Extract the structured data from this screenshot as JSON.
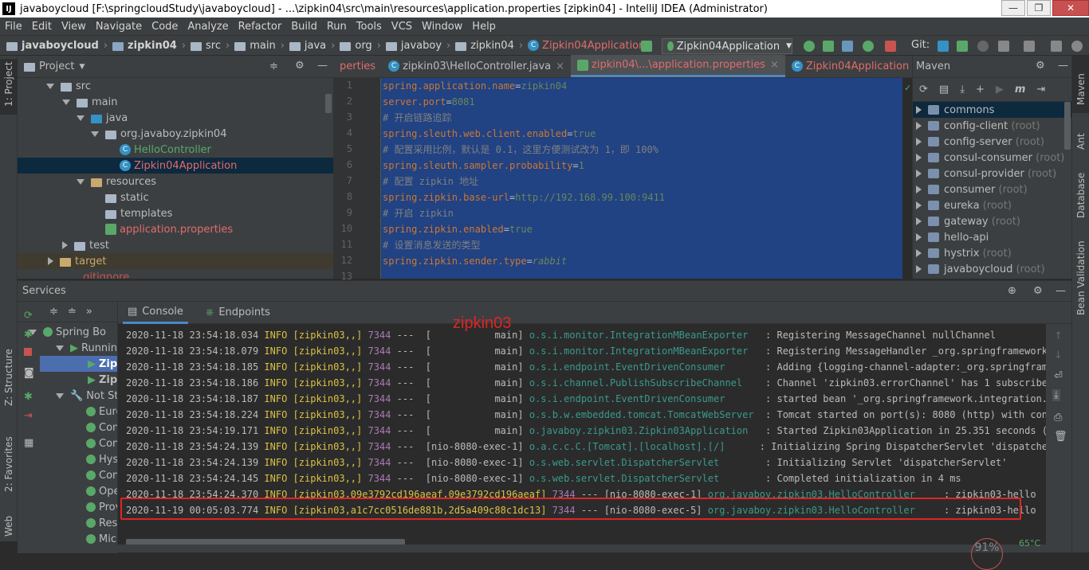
{
  "window": {
    "title": "javaboycloud [F:\\springcloudStudy\\javaboycloud] - ...\\zipkin04\\src\\main\\resources\\application.properties [zipkin04] - IntelliJ IDEA (Administrator)",
    "app_icon": "IJ"
  },
  "menu": [
    "File",
    "Edit",
    "View",
    "Navigate",
    "Code",
    "Analyze",
    "Refactor",
    "Build",
    "Run",
    "Tools",
    "VCS",
    "Window",
    "Help"
  ],
  "breadcrumb": [
    "javaboycloud",
    "zipkin04",
    "src",
    "main",
    "java",
    "org",
    "javaboy",
    "zipkin04",
    "Zipkin04Application"
  ],
  "run_config": "Zipkin04Application",
  "git_label": "Git:",
  "left_strip": {
    "project": "1: Project",
    "structure": "Z: Structure",
    "favorites": "2: Favorites",
    "web": "Web"
  },
  "right_strip": {
    "maven": "Maven",
    "ant": "Ant",
    "database": "Database",
    "bean": "Bean Validation"
  },
  "project_panel": {
    "title": "Project",
    "tree": [
      {
        "label": "src",
        "depth": 2,
        "open": true
      },
      {
        "label": "main",
        "depth": 3,
        "open": true
      },
      {
        "label": "java",
        "depth": 4,
        "open": true
      },
      {
        "label": "org.javaboy.zipkin04",
        "depth": 5,
        "open": true
      },
      {
        "label": "HelloController",
        "depth": 6
      },
      {
        "label": "Zipkin04Application",
        "depth": 6
      },
      {
        "label": "resources",
        "depth": 4,
        "open": true
      },
      {
        "label": "static",
        "depth": 5
      },
      {
        "label": "templates",
        "depth": 5
      },
      {
        "label": "application.properties",
        "depth": 5
      },
      {
        "label": "test",
        "depth": 3,
        "open": false
      },
      {
        "label": "target",
        "depth": 2,
        "open": false
      },
      {
        "label": ".gitignore",
        "depth": 2
      }
    ]
  },
  "editor": {
    "tabs": [
      "perties",
      "zipkin03\\HelloController.java",
      "zipkin04\\...\\application.properties",
      "Zipkin04Application"
    ],
    "lines": [
      {
        "n": "1",
        "key": "spring.application.name",
        "val": "zipkin04"
      },
      {
        "n": "2",
        "key": "server.port",
        "val": "8081"
      },
      {
        "n": "3",
        "comment": "# 开启链路追踪"
      },
      {
        "n": "4",
        "key": "spring.sleuth.web.client.enabled",
        "val": "true"
      },
      {
        "n": "5",
        "comment": "# 配置采用比例，默认是 0.1，这里方便测试改为 1，即 100%"
      },
      {
        "n": "6",
        "key": "spring.sleuth.sampler.probability",
        "val": "1"
      },
      {
        "n": "7",
        "comment": "# 配置 zipkin 地址"
      },
      {
        "n": "8",
        "key": "spring.zipkin.base-url",
        "val": "http://192.168.99.100:9411"
      },
      {
        "n": "9",
        "comment": "# 开启 zipkin"
      },
      {
        "n": "10",
        "key": "spring.zipkin.enabled",
        "val": "true"
      },
      {
        "n": "11",
        "comment": "# 设置消息发送的类型"
      },
      {
        "n": "12",
        "key": "spring.zipkin.sender.type",
        "val": "rabbit"
      },
      {
        "n": "13",
        "key": "",
        "val": ""
      }
    ]
  },
  "maven": {
    "title": "Maven",
    "projects": [
      {
        "name": "commons",
        "suffix": ""
      },
      {
        "name": "config-client",
        "suffix": "(root)"
      },
      {
        "name": "config-server",
        "suffix": "(root)"
      },
      {
        "name": "consul-consumer",
        "suffix": "(root)"
      },
      {
        "name": "consul-provider",
        "suffix": "(root)"
      },
      {
        "name": "consumer",
        "suffix": "(root)"
      },
      {
        "name": "eureka",
        "suffix": "(root)"
      },
      {
        "name": "gateway",
        "suffix": "(root)"
      },
      {
        "name": "hello-api",
        "suffix": ""
      },
      {
        "name": "hystrix",
        "suffix": "(root)"
      },
      {
        "name": "javaboycloud",
        "suffix": "(root)"
      }
    ]
  },
  "services": {
    "title": "Services",
    "tabs": [
      "Console",
      "Endpoints"
    ],
    "annotation": "zipkin03",
    "tree": [
      {
        "label": "Spring Bo",
        "indent": 14
      },
      {
        "label": "Runnin",
        "indent": 30
      },
      {
        "label": "Zip",
        "indent": 60
      },
      {
        "label": "Zip",
        "indent": 60
      },
      {
        "label": "Not Sta",
        "indent": 30
      },
      {
        "label": "Eure",
        "indent": 60
      },
      {
        "label": "Con",
        "indent": 60
      },
      {
        "label": "Con",
        "indent": 60
      },
      {
        "label": "Hys",
        "indent": 60
      },
      {
        "label": "Con",
        "indent": 60
      },
      {
        "label": "Ope",
        "indent": 60
      },
      {
        "label": "Prov",
        "indent": 60
      },
      {
        "label": "Res",
        "indent": 60
      },
      {
        "label": "Mic",
        "indent": 60
      }
    ],
    "log": [
      {
        "ts": "2020-11-18 23:54:18.034",
        "lvl": "INFO",
        "trace": "[zipkin03,,]",
        "pid": "7344",
        "thread": "---  [           main]",
        "logger": "o.s.i.monitor.IntegrationMBeanExporter  ",
        "msg": " : Registering MessageChannel nullChannel"
      },
      {
        "ts": "2020-11-18 23:54:18.079",
        "lvl": "INFO",
        "trace": "[zipkin03,,]",
        "pid": "7344",
        "thread": "---  [           main]",
        "logger": "o.s.i.monitor.IntegrationMBeanExporter  ",
        "msg": " : Registering MessageHandler _org.springframework.inte"
      },
      {
        "ts": "2020-11-18 23:54:18.185",
        "lvl": "INFO",
        "trace": "[zipkin03,,]",
        "pid": "7344",
        "thread": "---  [           main]",
        "logger": "o.s.i.endpoint.EventDrivenConsumer      ",
        "msg": " : Adding {logging-channel-adapter:_org.springframework"
      },
      {
        "ts": "2020-11-18 23:54:18.186",
        "lvl": "INFO",
        "trace": "[zipkin03,,]",
        "pid": "7344",
        "thread": "---  [           main]",
        "logger": "o.s.i.channel.PublishSubscribeChannel   ",
        "msg": " : Channel 'zipkin03.errorChannel' has 1 subscriber(s)."
      },
      {
        "ts": "2020-11-18 23:54:18.187",
        "lvl": "INFO",
        "trace": "[zipkin03,,]",
        "pid": "7344",
        "thread": "---  [           main]",
        "logger": "o.s.i.endpoint.EventDrivenConsumer      ",
        "msg": " : started bean '_org.springframework.integration.error"
      },
      {
        "ts": "2020-11-18 23:54:18.224",
        "lvl": "INFO",
        "trace": "[zipkin03,,]",
        "pid": "7344",
        "thread": "---  [           main]",
        "logger": "o.s.b.w.embedded.tomcat.TomcatWebServer ",
        "msg": " : Tomcat started on port(s): 8080 (http) with context"
      },
      {
        "ts": "2020-11-18 23:54:19.171",
        "lvl": "INFO",
        "trace": "[zipkin03,,]",
        "pid": "7344",
        "thread": "---  [           main]",
        "logger": "o.javaboy.zipkin03.Zipkin03Application  ",
        "msg": " : Started Zipkin03Application in 25.351 seconds (JVM r"
      },
      {
        "ts": "2020-11-18 23:54:24.139",
        "lvl": "INFO",
        "trace": "[zipkin03,,]",
        "pid": "7344",
        "thread": "---  [nio-8080-exec-1]",
        "logger": "o.a.c.c.C.[Tomcat].[localhost].[/]     ",
        "msg": " : Initializing Spring DispatcherServlet 'dispatcherSer"
      },
      {
        "ts": "2020-11-18 23:54:24.139",
        "lvl": "INFO",
        "trace": "[zipkin03,,]",
        "pid": "7344",
        "thread": "---  [nio-8080-exec-1]",
        "logger": "o.s.web.servlet.DispatcherServlet       ",
        "msg": " : Initializing Servlet 'dispatcherServlet'"
      },
      {
        "ts": "2020-11-18 23:54:24.145",
        "lvl": "INFO",
        "trace": "[zipkin03,,]",
        "pid": "7344",
        "thread": "---  [nio-8080-exec-1]",
        "logger": "o.s.web.servlet.DispatcherServlet       ",
        "msg": " : Completed initialization in 4 ms"
      },
      {
        "ts": "2020-11-18 23:54:24.370",
        "lvl": "INFO",
        "trace": "[zipkin03,09e3792cd196aeaf,09e3792cd196aeaf]",
        "pid": "7344",
        "thread": "--- [nio-8080-exec-1]",
        "logger": "org.javaboy.zipkin03.HelloController    ",
        "msg": " : zipkin03-hello"
      },
      {
        "ts": "2020-11-19 00:05:03.774",
        "lvl": "INFO",
        "trace": "[zipkin03,a1c7cc0516de881b,2d5a409c88c1dc13]",
        "pid": "7344",
        "thread": "--- [nio-8080-exec-5]",
        "logger": "org.javaboy.zipkin03.HelloController    ",
        "msg": " : zipkin03-hello"
      }
    ],
    "highlight_color": "#e02424"
  },
  "status": {
    "percent": "91%",
    "temp": "65°C"
  }
}
